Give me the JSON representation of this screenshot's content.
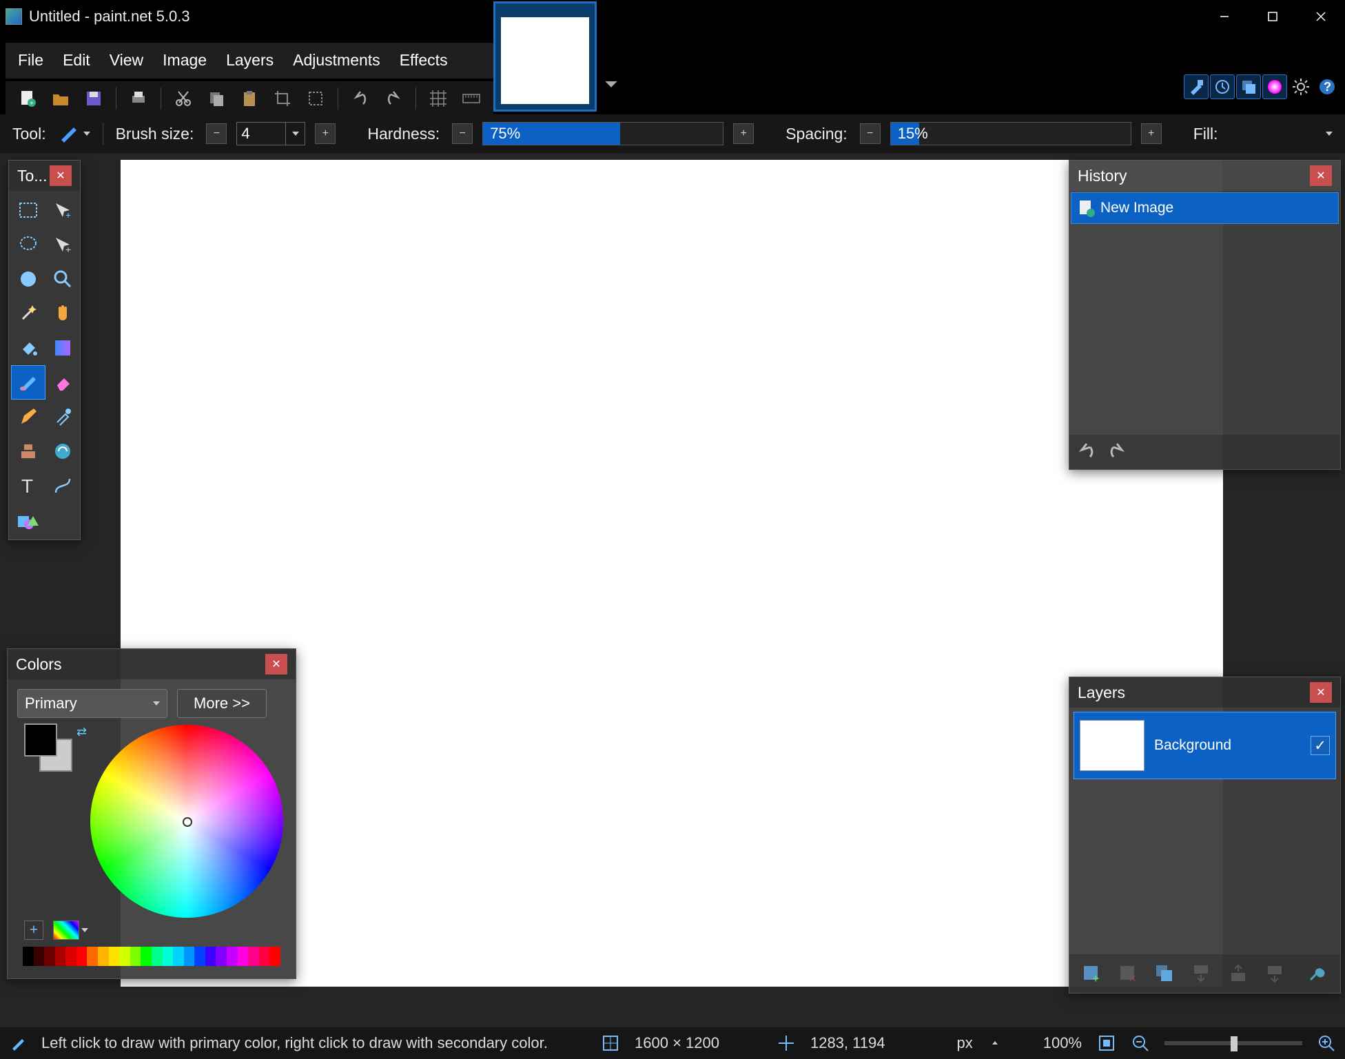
{
  "window": {
    "title": "Untitled - paint.net 5.0.3"
  },
  "menu": {
    "items": [
      "File",
      "Edit",
      "View",
      "Image",
      "Layers",
      "Adjustments",
      "Effects"
    ]
  },
  "options": {
    "tool_label": "Tool:",
    "brush_label": "Brush size:",
    "brush_value": "4",
    "hardness_label": "Hardness:",
    "hardness_value": "75%",
    "hardness_pct": 57,
    "spacing_label": "Spacing:",
    "spacing_value": "15%",
    "spacing_pct": 12,
    "fill_label": "Fill:"
  },
  "tools_panel": {
    "title": "To..."
  },
  "history": {
    "title": "History",
    "items": [
      "New Image"
    ]
  },
  "colors": {
    "title": "Colors",
    "primary_label": "Primary",
    "more_label": "More >>",
    "palette": [
      "#000",
      "#3a0000",
      "#6b0000",
      "#a80000",
      "#d80000",
      "#ff0000",
      "#ff6a00",
      "#ffb400",
      "#ffe000",
      "#d4ff00",
      "#7bff00",
      "#00ff00",
      "#00ff88",
      "#00ffd8",
      "#00d4ff",
      "#0094ff",
      "#0042ff",
      "#3b00ff",
      "#8400ff",
      "#c800ff",
      "#ff00e0",
      "#ff0088",
      "#ff0040",
      "#ff0000"
    ]
  },
  "layers": {
    "title": "Layers",
    "items": [
      {
        "name": "Background",
        "visible": true
      }
    ]
  },
  "status": {
    "hint": "Left click to draw with primary color, right click to draw with secondary color.",
    "dims": "1600 × 1200",
    "cursor": "1283, 1194",
    "unit": "px",
    "zoom": "100%"
  }
}
